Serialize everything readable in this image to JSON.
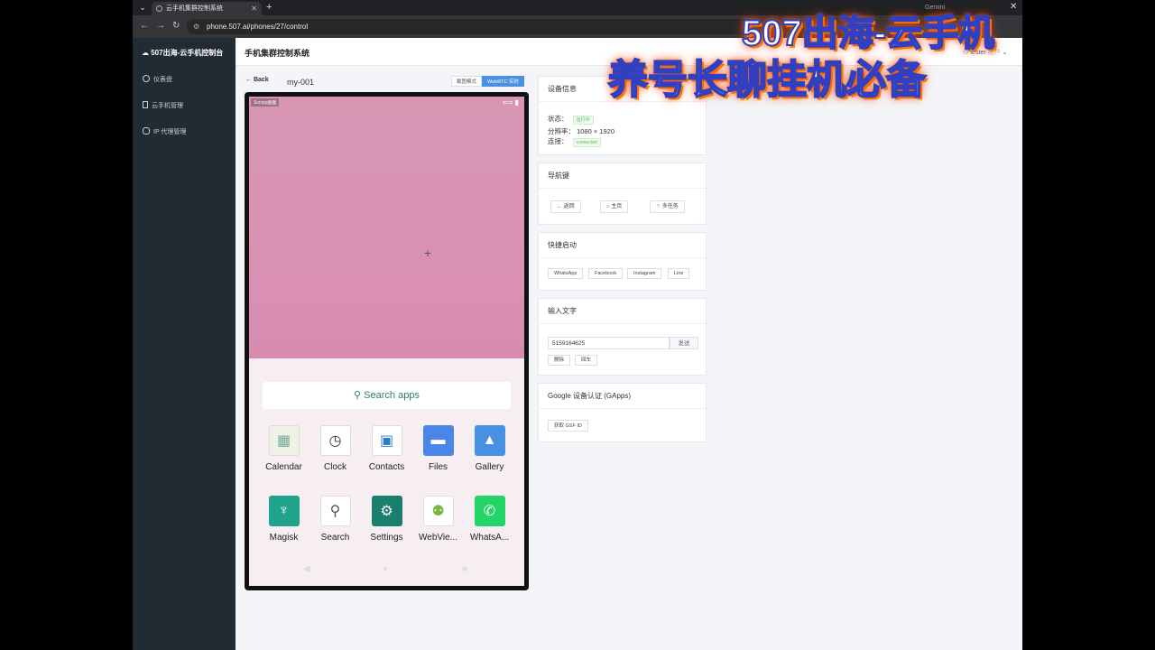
{
  "browser": {
    "tab_title": "云手机集群控制系统",
    "other_tab": "Gemini",
    "url": "phone.507.ai/phones/27/control"
  },
  "sidebar": {
    "brand": "507出海-云手机控制台",
    "items": [
      {
        "label": "仪表盘",
        "icon": "dashboard-icon"
      },
      {
        "label": "云手机管理",
        "icon": "phone-icon"
      },
      {
        "label": "IP 代理管理",
        "icon": "proxy-icon"
      }
    ]
  },
  "header": {
    "title": "手机集群控制系统",
    "user": "tester",
    "user_extra": "账户"
  },
  "control": {
    "back_label": "Back",
    "device_name": "my-001",
    "mode_screenshot": "截图模式",
    "mode_webrtc": "WebRTC 实时"
  },
  "phone": {
    "status_left": "Scrcpy画面",
    "search_label": "Search apps",
    "apps": [
      {
        "label": "Calendar",
        "icon": "calendar-icon",
        "color": "#e8f0e0"
      },
      {
        "label": "Clock",
        "icon": "clock-icon",
        "color": "#ffffff"
      },
      {
        "label": "Contacts",
        "icon": "contacts-icon",
        "color": "#ffffff"
      },
      {
        "label": "Files",
        "icon": "files-icon",
        "color": "#4a86e8"
      },
      {
        "label": "Gallery",
        "icon": "gallery-icon",
        "color": "#4a90e2"
      },
      {
        "label": "Magisk",
        "icon": "magisk-icon",
        "color": "#1fa38a"
      },
      {
        "label": "Search",
        "icon": "search-icon",
        "color": "#ffffff"
      },
      {
        "label": "Settings",
        "icon": "settings-icon",
        "color": "#1a7f6e"
      },
      {
        "label": "WebVie...",
        "icon": "android-icon",
        "color": "#ffffff"
      },
      {
        "label": "WhatsA...",
        "icon": "whatsapp-icon",
        "color": "#25d366"
      }
    ]
  },
  "device_info": {
    "title": "设备信息",
    "status_label": "状态：",
    "status_value": "运行中",
    "resolution_label": "分辨率：",
    "resolution_value": "1080 × 1920",
    "connection_label": "连接：",
    "connection_value": "connected"
  },
  "nav_keys": {
    "title": "导航键",
    "back": "返回",
    "home": "主页",
    "multitask": "多任务"
  },
  "quick_launch": {
    "title": "快捷启动",
    "apps": [
      "WhatsApp",
      "Facebook",
      "Instagram",
      "Line"
    ]
  },
  "text_input": {
    "title": "输入文字",
    "value": "5159164625",
    "send": "发送",
    "delete": "删除",
    "enter": "回车"
  },
  "gapps": {
    "title": "Google 设备认证 (GApps)",
    "button": "获取 GSF ID"
  },
  "overlay": {
    "line1": "507出海-云手机",
    "line2": "养号长聊挂机必备"
  }
}
